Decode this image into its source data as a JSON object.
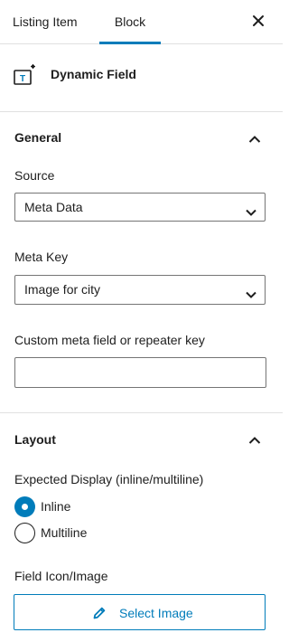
{
  "tabs": [
    {
      "label": "Listing Item"
    },
    {
      "label": "Block"
    }
  ],
  "block": {
    "title": "Dynamic Field",
    "icon": "dynamic-field-icon"
  },
  "general": {
    "title": "General",
    "source_label": "Source",
    "source_value": "Meta Data",
    "meta_key_label": "Meta Key",
    "meta_key_value": "Image for city",
    "custom_key_label": "Custom meta field or repeater key",
    "custom_key_value": ""
  },
  "layout": {
    "title": "Layout",
    "display_label": "Expected Display (inline/multiline)",
    "options": [
      {
        "label": "Inline",
        "selected": true
      },
      {
        "label": "Multiline",
        "selected": false
      }
    ],
    "icon_label": "Field Icon/Image",
    "select_image_label": "Select Image"
  },
  "colors": {
    "accent": "#007cba",
    "border": "#757575",
    "divider": "#e0e0e0"
  }
}
